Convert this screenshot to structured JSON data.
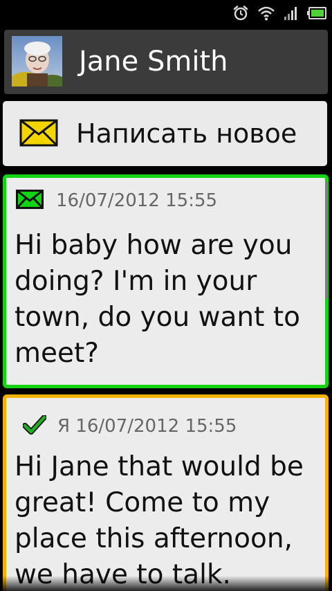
{
  "status_bar": {
    "icons": [
      "alarm-icon",
      "wifi-icon",
      "signal-icon",
      "battery-icon"
    ],
    "accent": "#4fd13a"
  },
  "contact": {
    "name": "Jane Smith"
  },
  "compose": {
    "label": "Написать новое",
    "icon": "envelope-icon",
    "icon_color": "#f2d400"
  },
  "messages": [
    {
      "direction": "received",
      "icon": "envelope-icon",
      "timestamp": "16/07/2012 15:55",
      "text": "Hi baby how are you doing? I'm in your town, do you want to meet?",
      "border_color": "#12d412"
    },
    {
      "direction": "sent",
      "icon": "checkmark-icon",
      "sender": "Я",
      "timestamp": "Я 16/07/2012 15:55",
      "text": "Hi Jane that would be great! Come to my place this afternoon, we have to talk.",
      "border_color": "#f4b300"
    }
  ]
}
